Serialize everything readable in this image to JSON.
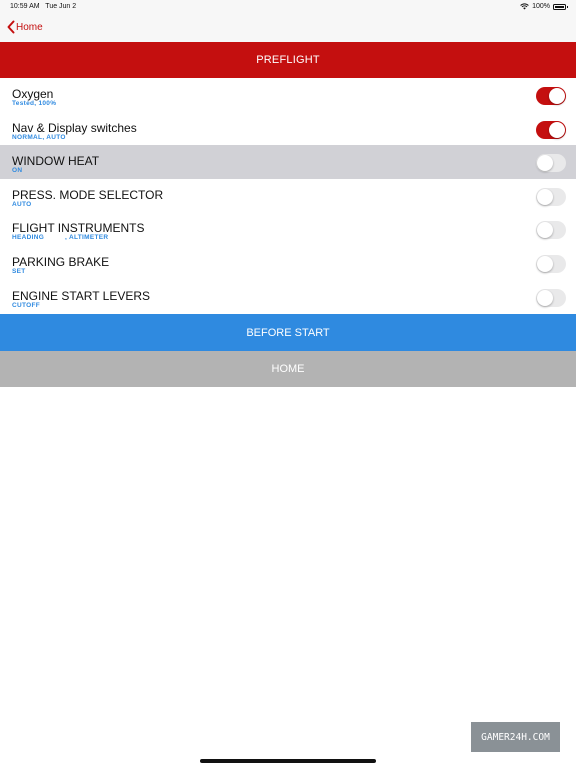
{
  "status_bar": {
    "time": "10:59 AM",
    "date": "Tue Jun 2",
    "battery": "100%"
  },
  "nav": {
    "back_label": "Home",
    "back_icon": "chevron-left-icon"
  },
  "header": {
    "title": "PREFLIGHT"
  },
  "items": [
    {
      "title": "Oxygen",
      "subtitle": "Tested, 100%",
      "subtitle2": "",
      "on": true
    },
    {
      "title": "Nav & Display switches",
      "subtitle": "NORMAL, AUTO",
      "subtitle2": "",
      "on": true
    },
    {
      "title": "WINDOW HEAT",
      "subtitle": "ON",
      "subtitle2": "",
      "on": false
    },
    {
      "title": "PRESS. MODE SELECTOR",
      "subtitle": "AUTO",
      "subtitle2": "",
      "on": false
    },
    {
      "title": "FLIGHT INSTRUMENTS",
      "subtitle": "HEADING",
      "subtitle2": ", ALTIMETER",
      "on": false
    },
    {
      "title": "PARKING BRAKE",
      "subtitle": "SET",
      "subtitle2": "",
      "on": false
    },
    {
      "title": "ENGINE START LEVERS",
      "subtitle": "CUTOFF",
      "subtitle2": "",
      "on": false
    }
  ],
  "buttons": {
    "next_label": "BEFORE START",
    "home_label": "HOME"
  },
  "watermark": {
    "text": "GAMER24H.COM"
  },
  "colors": {
    "accent_red": "#c40f0f",
    "accent_blue": "#2f8ae0",
    "grey_button": "#b3b3b3",
    "highlight_row": "#d1d1d6"
  }
}
